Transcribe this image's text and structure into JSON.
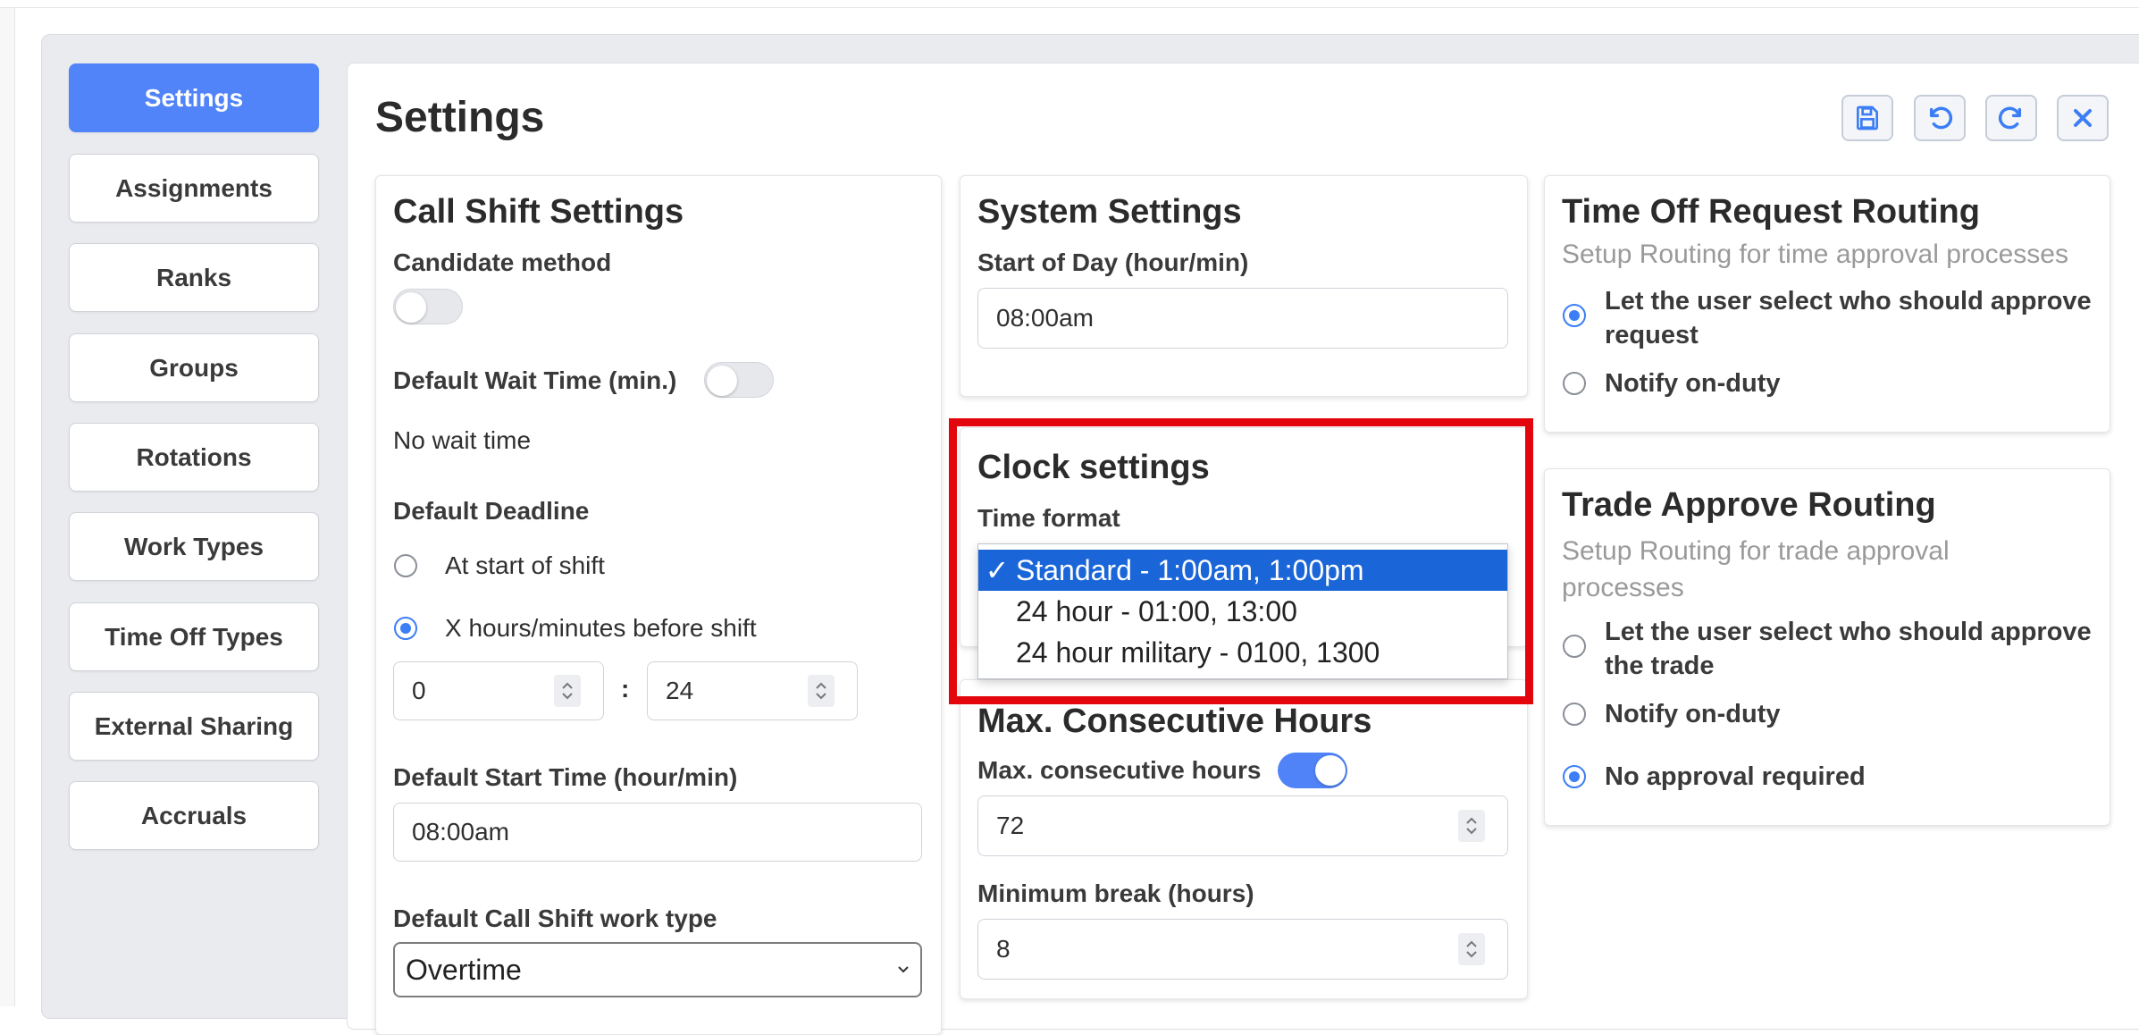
{
  "sidebar": {
    "items": [
      {
        "label": "Settings",
        "active": true
      },
      {
        "label": "Assignments"
      },
      {
        "label": "Ranks"
      },
      {
        "label": "Groups"
      },
      {
        "label": "Rotations"
      },
      {
        "label": "Work Types"
      },
      {
        "label": "Time Off Types"
      },
      {
        "label": "External Sharing"
      },
      {
        "label": "Accruals"
      }
    ]
  },
  "header": {
    "title": "Settings",
    "toolbar": [
      {
        "icon": "save-icon"
      },
      {
        "icon": "undo-icon"
      },
      {
        "icon": "redo-icon"
      },
      {
        "icon": "close-icon"
      }
    ],
    "accent": "#5084f8"
  },
  "call_shift": {
    "title": "Call Shift Settings",
    "candidate_method_label": "Candidate method",
    "candidate_method_enabled": false,
    "wait_time_label": "Default Wait Time (min.)",
    "wait_time_enabled": false,
    "wait_time_value": "No wait time",
    "deadline_label": "Default Deadline",
    "deadline_options": [
      "At start of shift",
      "X hours/minutes before shift"
    ],
    "deadline_selected": "X hours/minutes before shift",
    "deadline_hours": "0",
    "deadline_separator": ":",
    "deadline_minutes": "24",
    "start_time_label": "Default Start Time (hour/min)",
    "start_time_value": "08:00am",
    "work_type_label": "Default Call Shift work type",
    "work_type_value": "Overtime"
  },
  "system": {
    "title": "System Settings",
    "start_of_day_label": "Start of Day (hour/min)",
    "start_of_day_value": "08:00am"
  },
  "clock": {
    "title": "Clock settings",
    "time_format_label": "Time format",
    "check_glyph": "✓",
    "options": [
      "Standard - 1:00am, 1:00pm",
      "24 hour - 01:00, 13:00",
      "24 hour military - 0100, 1300"
    ],
    "selected": "Standard - 1:00am, 1:00pm",
    "highlight_color": "#e3060d"
  },
  "max_hours": {
    "title": "Max. Consecutive Hours",
    "toggle_label": "Max. consecutive hours",
    "toggle_enabled": true,
    "hours_value": "72",
    "min_break_label": "Minimum break (hours)",
    "min_break_value": "8"
  },
  "time_off_routing": {
    "title": "Time Off Request Routing",
    "subtitle": "Setup Routing for time approval processes",
    "options": [
      "Let the user select who should approve request",
      "Notify on-duty"
    ],
    "selected": "Let the user select who should approve request"
  },
  "trade_routing": {
    "title": "Trade Approve Routing",
    "subtitle": "Setup Routing for trade approval processes",
    "options": [
      "Let the user select who should approve the trade",
      "Notify on-duty",
      "No approval required"
    ],
    "selected": "No approval required"
  }
}
